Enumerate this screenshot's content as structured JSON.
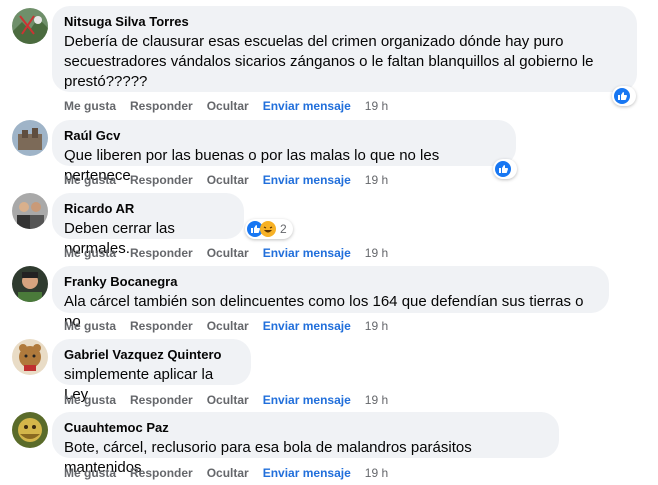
{
  "actions": {
    "like": "Me gusta",
    "reply": "Responder",
    "hide": "Ocultar",
    "message": "Enviar mensaje"
  },
  "colors": {
    "bubble": "#f0f2f5",
    "link_blue": "#216fdb",
    "like_blue": "#1877f2",
    "muted": "#65676b"
  },
  "comments": [
    {
      "author": "Nitsuga Silva Torres",
      "lines": [
        "Debería de clausurar esas escuelas del crimen organizado dónde hay puro",
        "secuestradores vándalos sicarios zánganos o le faltan blanquillos al gobierno le",
        "prestó?????"
      ],
      "time": "19 h",
      "reaction": "like"
    },
    {
      "author": "Raúl Gcv",
      "lines": [
        "Que liberen por las buenas o por las malas lo que no les pertenece"
      ],
      "time": "19 h",
      "reaction": "like"
    },
    {
      "author": "Ricardo AR",
      "lines": [
        "Deben cerrar las normales."
      ],
      "time": "19 h",
      "reaction": "like-haha",
      "reaction_count": "2"
    },
    {
      "author": "Franky Bocanegra",
      "lines": [
        "Ala cárcel también son delincuentes como los 164 que defendían sus tierras o no"
      ],
      "time": "19 h"
    },
    {
      "author": "Gabriel Vazquez Quintero",
      "lines": [
        "simplemente aplicar la Ley"
      ],
      "time": "19 h"
    },
    {
      "author": "Cuauhtemoc Paz",
      "lines": [
        "Bote, cárcel, reclusorio para esa bola de malandros parásitos mantenidos"
      ],
      "time": "19 h"
    }
  ]
}
